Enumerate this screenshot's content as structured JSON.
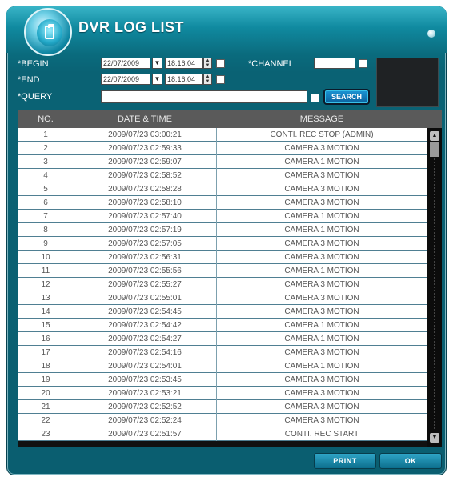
{
  "window": {
    "title": "DVR LOG LIST",
    "icon": "clipboard-icon",
    "close_icon": "close-dot-icon",
    "accent": "#0a6274"
  },
  "filters": {
    "begin": {
      "label": "BEGIN",
      "date": "22/07/2009",
      "time": "18:16:04"
    },
    "end": {
      "label": "END",
      "date": "22/07/2009",
      "time": "18:16:04"
    },
    "channel": {
      "label": "CHANNEL",
      "value": ""
    },
    "query": {
      "label": "QUERY",
      "value": ""
    },
    "search_label": "SEARCH"
  },
  "table": {
    "headers": [
      "NO.",
      "DATE & TIME",
      "MESSAGE"
    ],
    "rows": [
      {
        "no": "1",
        "datetime": "2009/07/23 03:00:21",
        "message": "CONTI. REC STOP (ADMIN)"
      },
      {
        "no": "2",
        "datetime": "2009/07/23 02:59:33",
        "message": "CAMERA 3 MOTION"
      },
      {
        "no": "3",
        "datetime": "2009/07/23 02:59:07",
        "message": "CAMERA 1 MOTION"
      },
      {
        "no": "4",
        "datetime": "2009/07/23 02:58:52",
        "message": "CAMERA 3 MOTION"
      },
      {
        "no": "5",
        "datetime": "2009/07/23 02:58:28",
        "message": "CAMERA 3 MOTION"
      },
      {
        "no": "6",
        "datetime": "2009/07/23 02:58:10",
        "message": "CAMERA 3 MOTION"
      },
      {
        "no": "7",
        "datetime": "2009/07/23 02:57:40",
        "message": "CAMERA 1 MOTION"
      },
      {
        "no": "8",
        "datetime": "2009/07/23 02:57:19",
        "message": "CAMERA 1 MOTION"
      },
      {
        "no": "9",
        "datetime": "2009/07/23 02:57:05",
        "message": "CAMERA 3 MOTION"
      },
      {
        "no": "10",
        "datetime": "2009/07/23 02:56:31",
        "message": "CAMERA 3 MOTION"
      },
      {
        "no": "11",
        "datetime": "2009/07/23 02:55:56",
        "message": "CAMERA 1 MOTION"
      },
      {
        "no": "12",
        "datetime": "2009/07/23 02:55:27",
        "message": "CAMERA 3 MOTION"
      },
      {
        "no": "13",
        "datetime": "2009/07/23 02:55:01",
        "message": "CAMERA 3 MOTION"
      },
      {
        "no": "14",
        "datetime": "2009/07/23 02:54:45",
        "message": "CAMERA 3 MOTION"
      },
      {
        "no": "15",
        "datetime": "2009/07/23 02:54:42",
        "message": "CAMERA 1 MOTION"
      },
      {
        "no": "16",
        "datetime": "2009/07/23 02:54:27",
        "message": "CAMERA 1 MOTION"
      },
      {
        "no": "17",
        "datetime": "2009/07/23 02:54:16",
        "message": "CAMERA 3 MOTION"
      },
      {
        "no": "18",
        "datetime": "2009/07/23 02:54:01",
        "message": "CAMERA 1 MOTION"
      },
      {
        "no": "19",
        "datetime": "2009/07/23 02:53:45",
        "message": "CAMERA 3 MOTION"
      },
      {
        "no": "20",
        "datetime": "2009/07/23 02:53:21",
        "message": "CAMERA 3 MOTION"
      },
      {
        "no": "21",
        "datetime": "2009/07/23 02:52:52",
        "message": "CAMERA 3 MOTION"
      },
      {
        "no": "22",
        "datetime": "2009/07/23 02:52:24",
        "message": "CAMERA 3 MOTION"
      },
      {
        "no": "23",
        "datetime": "2009/07/23 02:51:57",
        "message": "CONTI. REC START"
      }
    ]
  },
  "footer": {
    "print_label": "PRINT",
    "ok_label": "OK"
  }
}
